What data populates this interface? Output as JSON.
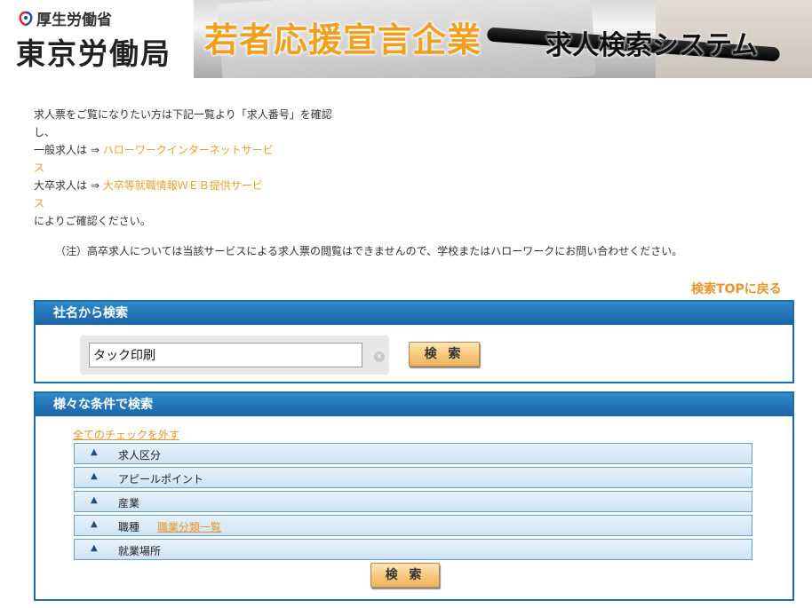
{
  "header": {
    "ministry": "厚生労働省",
    "bureau": "東京労働局",
    "banner_title": "若者応援宣言企業",
    "banner_subtitle": "求人検索システム"
  },
  "intro": {
    "line1": "求人票をご覧になりたい方は下記一覧より「求人番号」を確認",
    "line2": "し、",
    "general_prefix": "一般求人は ⇒ ",
    "general_link_a": "ハローワークインターネットサービ",
    "general_link_b": "ス",
    "grad_prefix": "大卒求人は ⇒ ",
    "grad_link_a": "大卒等就職情報ＷＥＢ提供サービ",
    "grad_link_b": "ス",
    "line_end": "によりご確認ください。"
  },
  "note": "（注）高卒求人については当該サービスによる求人票の閲覧はできませんので、学校またはハローワークにお問い合わせください。",
  "back_top": "検索TOPに戻る",
  "company_search": {
    "heading": "社名から検索",
    "input_value": "タック印刷",
    "button": "検 索"
  },
  "condition_search": {
    "heading": "様々な条件で検索",
    "uncheck_all": "全てのチェックを外す",
    "categories": [
      {
        "label": "求人区分"
      },
      {
        "label": "アピールポイント"
      },
      {
        "label": "産業"
      },
      {
        "label": "職種",
        "link": "職業分類一覧"
      },
      {
        "label": "就業場所"
      }
    ],
    "button": "検 索"
  },
  "icons": {
    "expand": "▲",
    "clear": "×"
  }
}
